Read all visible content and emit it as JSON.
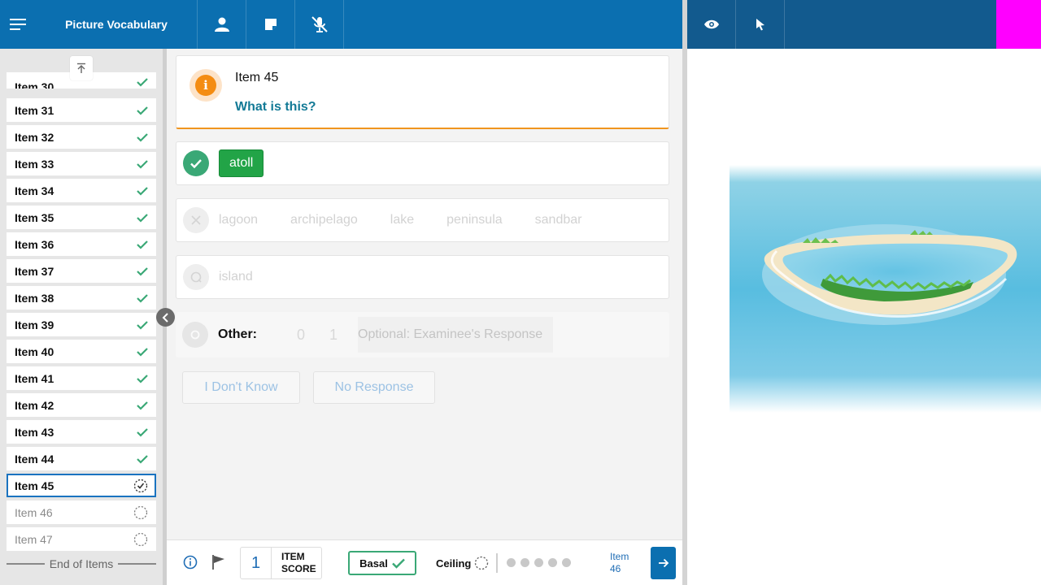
{
  "app": {
    "title": "Picture Vocabulary"
  },
  "toolbar": {
    "left_icons": [
      "menu-icon",
      "person-icon",
      "note-icon",
      "mic-off-icon"
    ],
    "right_icons": [
      "eye-icon",
      "pointer-icon"
    ]
  },
  "sidebar": {
    "partial_item": "Item 30",
    "items": [
      {
        "label": "Item 31",
        "status": "done"
      },
      {
        "label": "Item 32",
        "status": "done"
      },
      {
        "label": "Item 33",
        "status": "done"
      },
      {
        "label": "Item 34",
        "status": "done"
      },
      {
        "label": "Item 35",
        "status": "done"
      },
      {
        "label": "Item 36",
        "status": "done"
      },
      {
        "label": "Item 37",
        "status": "done"
      },
      {
        "label": "Item 38",
        "status": "done"
      },
      {
        "label": "Item 39",
        "status": "done"
      },
      {
        "label": "Item 40",
        "status": "done"
      },
      {
        "label": "Item 41",
        "status": "done"
      },
      {
        "label": "Item 42",
        "status": "done"
      },
      {
        "label": "Item 43",
        "status": "done"
      },
      {
        "label": "Item 44",
        "status": "done"
      },
      {
        "label": "Item 45",
        "status": "current"
      },
      {
        "label": "Item 46",
        "status": "pending"
      },
      {
        "label": "Item 47",
        "status": "pending"
      }
    ],
    "end_label": "End of Items"
  },
  "question": {
    "item_label": "Item 45",
    "prompt": "What is this?"
  },
  "correct_answer": "atoll",
  "incorrect_options": [
    "lagoon",
    "archipelago",
    "lake",
    "peninsula",
    "sandbar"
  ],
  "query_options": [
    "island"
  ],
  "other": {
    "label": "Other:",
    "score_0": "0",
    "score_1": "1",
    "placeholder": "Optional: Examinee's Response"
  },
  "buttons": {
    "dont_know": "I Don't Know",
    "no_response": "No Response"
  },
  "footer": {
    "item_score": "1",
    "item_score_label_1": "ITEM",
    "item_score_label_2": "SCORE",
    "basal_label": "Basal",
    "ceiling_label": "Ceiling",
    "ceiling_dots": 5,
    "next_label_1": "Item",
    "next_label_2": "46"
  },
  "colors": {
    "topbar": "#0b6fb0",
    "topbar_right": "#125a8e",
    "correct": "#3aa876",
    "answer_chip": "#22a447",
    "prompt": "#137a96",
    "info": "#f48c12",
    "marker": "#ff00ff"
  }
}
